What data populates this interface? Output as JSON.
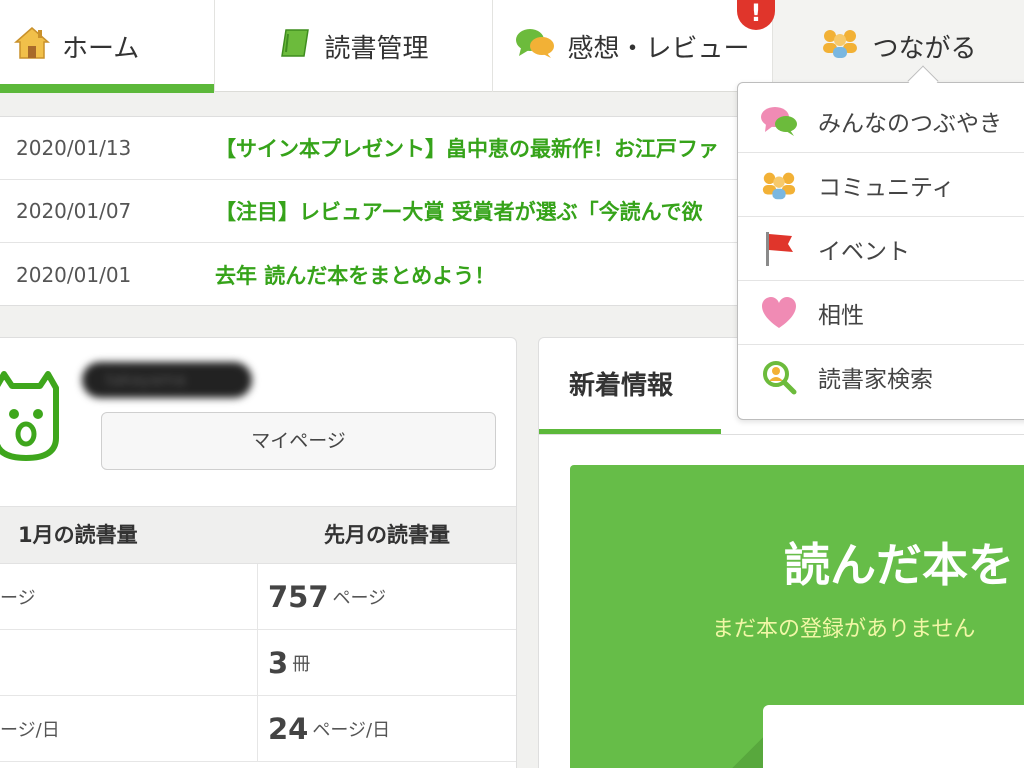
{
  "nav": {
    "tabs": [
      {
        "label": "ホーム",
        "icon": "house-icon",
        "active": true
      },
      {
        "label": "読書管理",
        "icon": "book-icon",
        "active": false
      },
      {
        "label": "感想・レビュー",
        "icon": "speech-bubbles-icon",
        "active": false
      },
      {
        "label": "つながる",
        "icon": "people-icon",
        "active": false
      }
    ],
    "alert_badge": "!"
  },
  "news": [
    {
      "date": "2020/01/13",
      "title": "【サイン本プレゼント】畠中恵の最新作！お江戸ファ"
    },
    {
      "date": "2020/01/07",
      "title": "【注目】レビュアー大賞 受賞者が選ぶ「今読んで欲"
    },
    {
      "date": "2020/01/01",
      "title": "去年 読んだ本をまとめよう！"
    }
  ],
  "profile": {
    "username": "takayama",
    "mypage_label": "マイページ",
    "stats_headers": [
      "1月の読書量",
      "先月の読書量"
    ],
    "rows": [
      {
        "left": "ージ",
        "right_num": "757",
        "right_unit": "ページ"
      },
      {
        "left": "",
        "right_num": "3",
        "right_unit": "冊"
      },
      {
        "left": "ージ/日",
        "right_num": "24",
        "right_unit": "ページ/日"
      }
    ]
  },
  "feed": {
    "tab_label": "新着情報",
    "headline": "読んだ本を",
    "subtext": "まだ本の登録がありません"
  },
  "dropdown": {
    "items": [
      {
        "label": "みんなのつぶやき",
        "icon": "speech-bubbles-icon"
      },
      {
        "label": "コミュニティ",
        "icon": "people-icon"
      },
      {
        "label": "イベント",
        "icon": "flag-icon"
      },
      {
        "label": "相性",
        "icon": "heart-icon"
      },
      {
        "label": "読書家検索",
        "icon": "search-person-icon"
      }
    ]
  },
  "colors": {
    "accent_green": "#5cb83a",
    "news_green": "#36a31a",
    "alert_red": "#e0352b"
  }
}
